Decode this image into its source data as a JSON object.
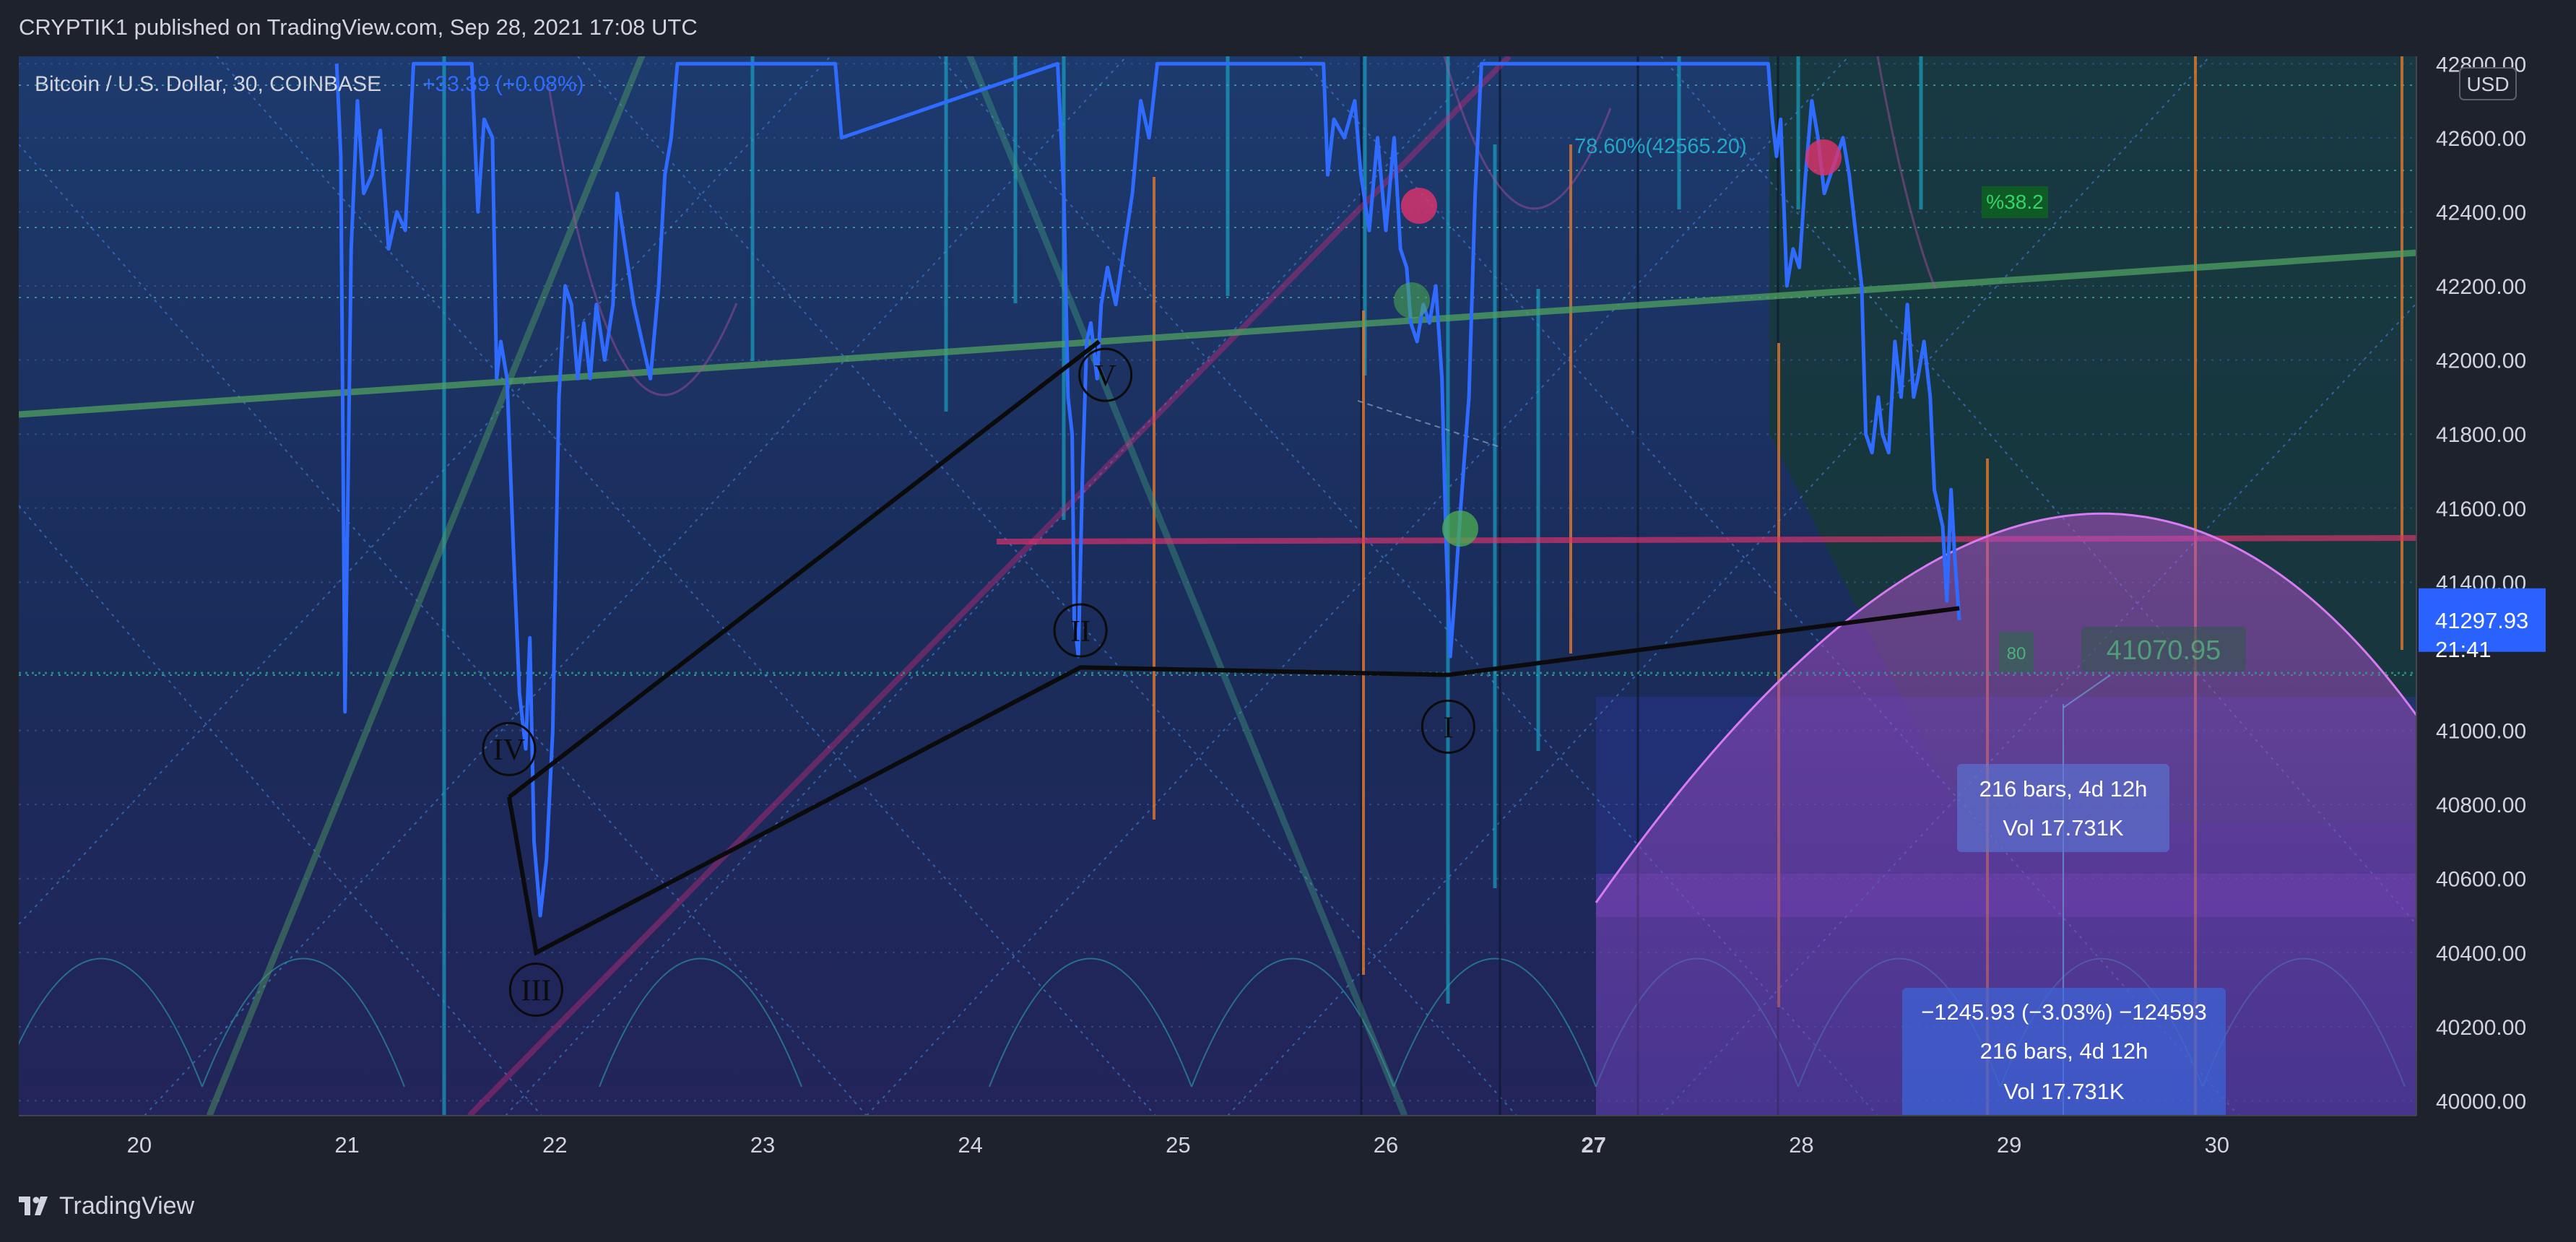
{
  "header": {
    "published_line": "CRYPTIK1 published on TradingView.com, Sep 28, 2021 17:08 UTC"
  },
  "legend": {
    "symbol": "Bitcoin / U.S. Dollar, 30, COINBASE",
    "change": "+33.39 (+0.08%)"
  },
  "footer": {
    "brand": "TradingView"
  },
  "colors": {
    "price_line": "#2f6bff",
    "trend_green": "#4caf50",
    "wave_black": "#0b0b0b",
    "arc_purple": "#c060e0",
    "resistance_red": "#e0336b",
    "last_price_bg": "#2962ff"
  },
  "annotations": {
    "fib_label": "78.60%(42565.20)",
    "fib_badge": "%38.2",
    "measure_upper_line1": "216 bars, 4d 12h",
    "measure_upper_line2": "Vol 17.731K",
    "measure_lower_line1": "−1245.93 (−3.03%) −124593",
    "measure_lower_line2": "216 bars, 4d 12h",
    "measure_lower_line3": "Vol 17.731K",
    "ghost_price": "41070.95",
    "ghost_small": "80",
    "last_price": "41297.93",
    "countdown": "21:41",
    "currency": "USD"
  },
  "chart_data": {
    "type": "line",
    "y_axis_ticks": [
      "42800.00",
      "42600.00",
      "42400.00",
      "42200.00",
      "42000.00",
      "41800.00",
      "41600.00",
      "41400.00",
      "41000.00",
      "40800.00",
      "40600.00",
      "40400.00",
      "40200.00",
      "40000.00"
    ],
    "x_axis_ticks": [
      {
        "label": "20",
        "t": 20.0
      },
      {
        "label": "21",
        "t": 21.0
      },
      {
        "label": "22",
        "t": 22.0
      },
      {
        "label": "23",
        "t": 23.0
      },
      {
        "label": "24",
        "t": 24.0
      },
      {
        "label": "25",
        "t": 25.0
      },
      {
        "label": "26",
        "t": 26.0
      },
      {
        "label": "27",
        "t": 27.0,
        "bold": true
      },
      {
        "label": "28",
        "t": 28.0
      },
      {
        "label": "29",
        "t": 29.0
      },
      {
        "label": "30",
        "t": 30.0
      }
    ],
    "ylim": [
      39960,
      42820
    ],
    "xlim": [
      19.42,
      30.96
    ],
    "last_price": 41297.93,
    "price_series": [
      [
        20.95,
        42800
      ],
      [
        20.97,
        42550
      ],
      [
        20.99,
        41050
      ],
      [
        21.02,
        42300
      ],
      [
        21.05,
        42700
      ],
      [
        21.08,
        42450
      ],
      [
        21.12,
        42500
      ],
      [
        21.16,
        42620
      ],
      [
        21.2,
        42300
      ],
      [
        21.24,
        42400
      ],
      [
        21.28,
        42350
      ],
      [
        21.32,
        42800
      ],
      [
        21.6,
        42800
      ],
      [
        21.63,
        42400
      ],
      [
        21.66,
        42650
      ],
      [
        21.7,
        42600
      ],
      [
        21.72,
        41950
      ],
      [
        21.74,
        42050
      ],
      [
        21.77,
        41950
      ],
      [
        21.8,
        41500
      ],
      [
        21.83,
        41100
      ],
      [
        21.86,
        40950
      ],
      [
        21.88,
        41250
      ],
      [
        21.9,
        40700
      ],
      [
        21.93,
        40500
      ],
      [
        21.96,
        40650
      ],
      [
        21.99,
        41000
      ],
      [
        22.02,
        41900
      ],
      [
        22.05,
        42200
      ],
      [
        22.08,
        42150
      ],
      [
        22.11,
        41950
      ],
      [
        22.14,
        42100
      ],
      [
        22.17,
        41950
      ],
      [
        22.2,
        42150
      ],
      [
        22.24,
        42000
      ],
      [
        22.28,
        42150
      ],
      [
        22.3,
        42450
      ],
      [
        22.34,
        42300
      ],
      [
        22.38,
        42150
      ],
      [
        22.42,
        42050
      ],
      [
        22.46,
        41950
      ],
      [
        22.5,
        42200
      ],
      [
        22.53,
        42500
      ],
      [
        22.56,
        42600
      ],
      [
        22.59,
        42800
      ],
      [
        23.35,
        42800
      ],
      [
        23.38,
        42600
      ],
      [
        24.42,
        42800
      ],
      [
        24.45,
        42450
      ],
      [
        24.47,
        41900
      ],
      [
        24.49,
        41800
      ],
      [
        24.5,
        41300
      ],
      [
        24.52,
        41200
      ],
      [
        24.54,
        41700
      ],
      [
        24.56,
        42050
      ],
      [
        24.58,
        42100
      ],
      [
        24.61,
        41950
      ],
      [
        24.63,
        42150
      ],
      [
        24.66,
        42250
      ],
      [
        24.7,
        42150
      ],
      [
        24.74,
        42300
      ],
      [
        24.78,
        42450
      ],
      [
        24.82,
        42700
      ],
      [
        24.86,
        42600
      ],
      [
        24.9,
        42800
      ],
      [
        25.7,
        42800
      ],
      [
        25.72,
        42500
      ],
      [
        25.75,
        42650
      ],
      [
        25.8,
        42600
      ],
      [
        25.85,
        42700
      ],
      [
        25.88,
        42500
      ],
      [
        25.92,
        42350
      ],
      [
        25.96,
        42600
      ],
      [
        26.0,
        42350
      ],
      [
        26.04,
        42600
      ],
      [
        26.07,
        42300
      ],
      [
        26.1,
        42250
      ],
      [
        26.12,
        42100
      ],
      [
        26.15,
        42050
      ],
      [
        26.18,
        42150
      ],
      [
        26.21,
        42100
      ],
      [
        26.24,
        42200
      ],
      [
        26.27,
        41950
      ],
      [
        26.29,
        41500
      ],
      [
        26.31,
        41200
      ],
      [
        26.33,
        41350
      ],
      [
        26.36,
        41600
      ],
      [
        26.4,
        41900
      ],
      [
        26.43,
        42450
      ],
      [
        26.46,
        42800
      ],
      [
        27.84,
        42800
      ],
      [
        27.86,
        42650
      ],
      [
        27.88,
        42550
      ],
      [
        27.9,
        42650
      ],
      [
        27.93,
        42200
      ],
      [
        27.96,
        42300
      ],
      [
        27.99,
        42250
      ],
      [
        28.02,
        42500
      ],
      [
        28.05,
        42700
      ],
      [
        28.08,
        42600
      ],
      [
        28.11,
        42450
      ],
      [
        28.14,
        42500
      ],
      [
        28.17,
        42550
      ],
      [
        28.2,
        42600
      ],
      [
        28.23,
        42500
      ],
      [
        28.26,
        42350
      ],
      [
        28.29,
        42200
      ],
      [
        28.31,
        41800
      ],
      [
        28.34,
        41750
      ],
      [
        28.37,
        41900
      ],
      [
        28.39,
        41800
      ],
      [
        28.42,
        41750
      ],
      [
        28.45,
        42050
      ],
      [
        28.48,
        41900
      ],
      [
        28.51,
        42150
      ],
      [
        28.54,
        41900
      ],
      [
        28.56,
        41950
      ],
      [
        28.59,
        42050
      ],
      [
        28.62,
        41900
      ],
      [
        28.64,
        41650
      ],
      [
        28.66,
        41600
      ],
      [
        28.68,
        41550
      ],
      [
        28.7,
        41350
      ],
      [
        28.72,
        41650
      ],
      [
        28.74,
        41450
      ],
      [
        28.76,
        41297.93
      ]
    ],
    "wave_labels": [
      "IV",
      "III",
      "II",
      "V",
      "I"
    ],
    "wave_path": [
      {
        "t": 21.78,
        "y": 40820
      },
      {
        "t": 21.91,
        "y": 40400
      },
      {
        "t": 24.53,
        "y": 41170
      },
      {
        "t": 26.3,
        "y": 41150
      },
      {
        "t": 28.76,
        "y": 41330
      }
    ],
    "wave_apex": {
      "t": 24.62,
      "y": 42050
    },
    "wave_label_points": {
      "IV": {
        "t": 21.78,
        "y": 40950
      },
      "III": {
        "t": 21.91,
        "y": 40300
      },
      "II": {
        "t": 24.53,
        "y": 41270
      },
      "V": {
        "t": 24.65,
        "y": 41960
      },
      "I": {
        "t": 26.3,
        "y": 41010
      }
    }
  }
}
